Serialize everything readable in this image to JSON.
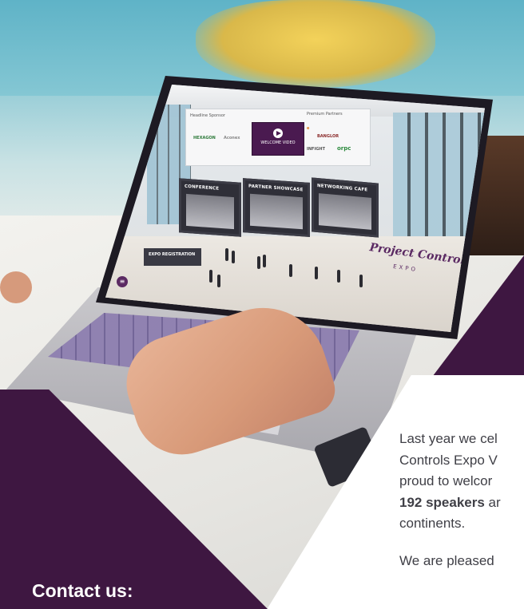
{
  "screen": {
    "sponsor_label_left": "Headline Sponsor",
    "sponsor_label_right": "Premium Partners",
    "welcome_video": "WELCOME VIDEO",
    "logos": {
      "hexagon": "HEXAGON",
      "small1": "Aconex",
      "p1": "e",
      "p2": "BANGLOR",
      "infight": "INFIGHT",
      "rpc": "orpc"
    },
    "booths": {
      "conference": "CONFERENCE",
      "partner": "PARTNER SHOWCASE",
      "networking": "NETWORKING CAFE"
    },
    "registration": "EXPO REGISTRATION",
    "brand": "Project Controls",
    "brand_sub": "EXPO"
  },
  "contact": {
    "title": "Contact us:"
  },
  "body": {
    "line1": "Last year we cel",
    "line2": "Controls Expo V",
    "line3": "proud to welcor",
    "line4_bold": "192 speakers",
    "line4_rest": " ar",
    "line5": "continents.",
    "line6": "We are pleased"
  },
  "colors": {
    "brand_purple": "#3e1741",
    "text": "#3f3f46"
  }
}
